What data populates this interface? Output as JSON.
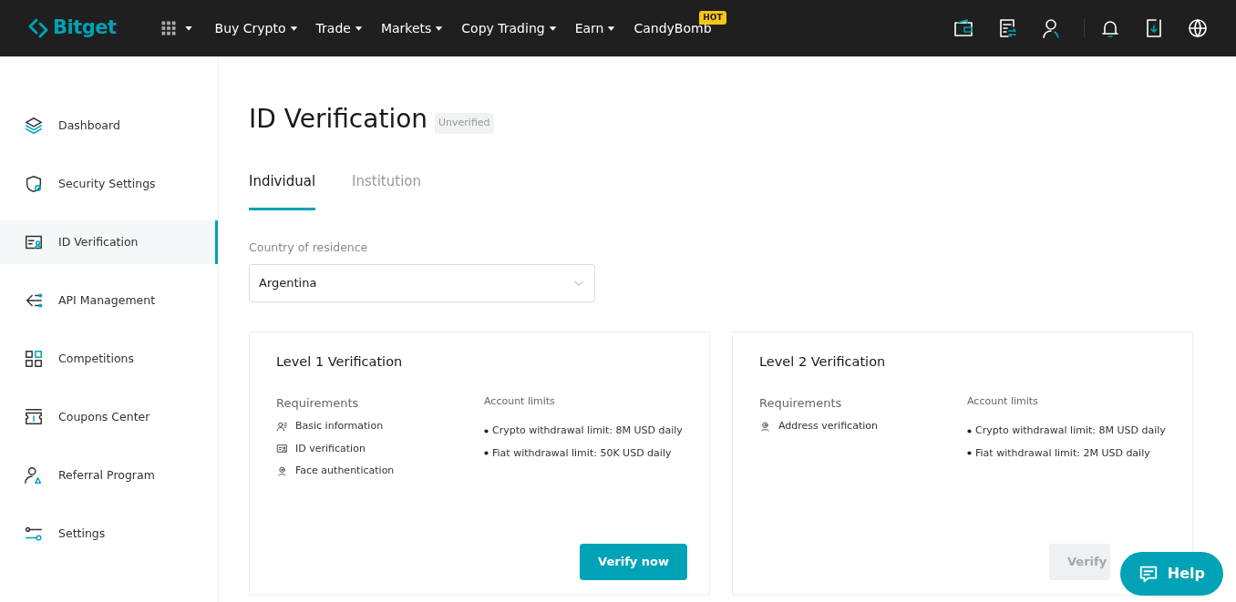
{
  "header": {
    "logo": "Bitget",
    "nav": [
      {
        "label": "Buy Crypto",
        "dropdown": true
      },
      {
        "label": "Trade",
        "dropdown": true
      },
      {
        "label": "Markets",
        "dropdown": true
      },
      {
        "label": "Copy Trading",
        "dropdown": true
      },
      {
        "label": "Earn",
        "dropdown": true
      },
      {
        "label": "CandyBomb",
        "dropdown": false,
        "badge": "HOT"
      }
    ]
  },
  "sidebar": {
    "items": [
      {
        "label": "Dashboard",
        "selected": false
      },
      {
        "label": "Security Settings",
        "selected": false
      },
      {
        "label": "ID Verification",
        "selected": true
      },
      {
        "label": "API Management",
        "selected": false
      },
      {
        "label": "Competitions",
        "selected": false
      },
      {
        "label": "Coupons Center",
        "selected": false
      },
      {
        "label": "Referral Program",
        "selected": false
      },
      {
        "label": "Settings",
        "selected": false
      }
    ]
  },
  "page": {
    "title": "ID Verification",
    "status": "Unverified",
    "tabs": [
      {
        "label": "Individual",
        "selected": true
      },
      {
        "label": "Institution",
        "selected": false
      }
    ],
    "country": {
      "label": "Country of residence",
      "value": "Argentina"
    },
    "levels": [
      {
        "title": "Level 1 Verification",
        "requirements_label": "Requirements",
        "requirements": [
          "Basic information",
          "ID verification",
          "Face authentication"
        ],
        "limits_label": "Account limits",
        "limits": [
          "Crypto withdrawal limit: 8M USD daily",
          "Fiat withdrawal limit: 50K USD daily"
        ],
        "button": "Verify now",
        "disabled": false
      },
      {
        "title": "Level 2 Verification",
        "requirements_label": "Requirements",
        "requirements": [
          "Address verification"
        ],
        "limits_label": "Account limits",
        "limits": [
          "Crypto withdrawal limit: 8M USD daily",
          "Fiat withdrawal limit: 2M USD daily"
        ],
        "button": "Verify",
        "disabled": true
      }
    ]
  },
  "help_button": "Help"
}
